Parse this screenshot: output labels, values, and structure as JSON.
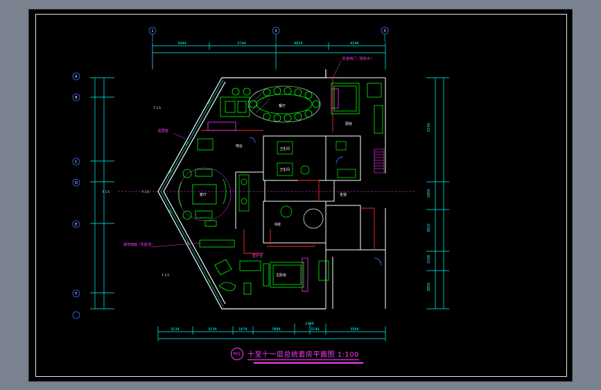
{
  "drawing": {
    "title": "十至十一层总统套房平面图",
    "scale": "1:100",
    "badge": "P01",
    "colors": {
      "background": "#000000",
      "walls": "#ffffff",
      "dimensions": "#00ffff",
      "furniture": "#00ff00",
      "annotation": "#ff3cff",
      "stair": "#ff3cff",
      "glass": "#00ffff",
      "red_walls": "#ff2a2a",
      "blue_doors": "#3a6bff"
    },
    "grid_bubbles": [
      "1",
      "2",
      "3"
    ],
    "row_bubbles": [
      "A",
      "B",
      "C",
      "D",
      "E",
      "F"
    ],
    "top_dimensions": [
      "3444",
      "3744",
      "4824",
      "4244"
    ],
    "bottom_dimensions": [
      "3134",
      "3134",
      "1874",
      "7884",
      "1444",
      "3584"
    ],
    "bottom_sub_dims": [
      "3744"
    ],
    "right_dimensions": [
      "5100",
      "1800",
      "3820",
      "1500",
      "3850"
    ],
    "room_labels": {
      "dining": "餐厅",
      "living": "客厅",
      "master_bedroom": "主卧房",
      "bath_1": "卫生间",
      "bath_2": "卫生间",
      "study": "书房",
      "kitchen": "厨房",
      "bar": "吧台",
      "entry": "入口",
      "corridor": "走道",
      "secretary": "秘书间"
    },
    "notes": {
      "top_right": "卧室用门（铝包木）",
      "left_mid": "起居室",
      "left_lower": "装饰墙面（乳胶漆）",
      "center": "壁炉台"
    },
    "levels": [
      "F 1.5",
      "F 1.5",
      "F 1.5",
      "F 1.5"
    ]
  }
}
